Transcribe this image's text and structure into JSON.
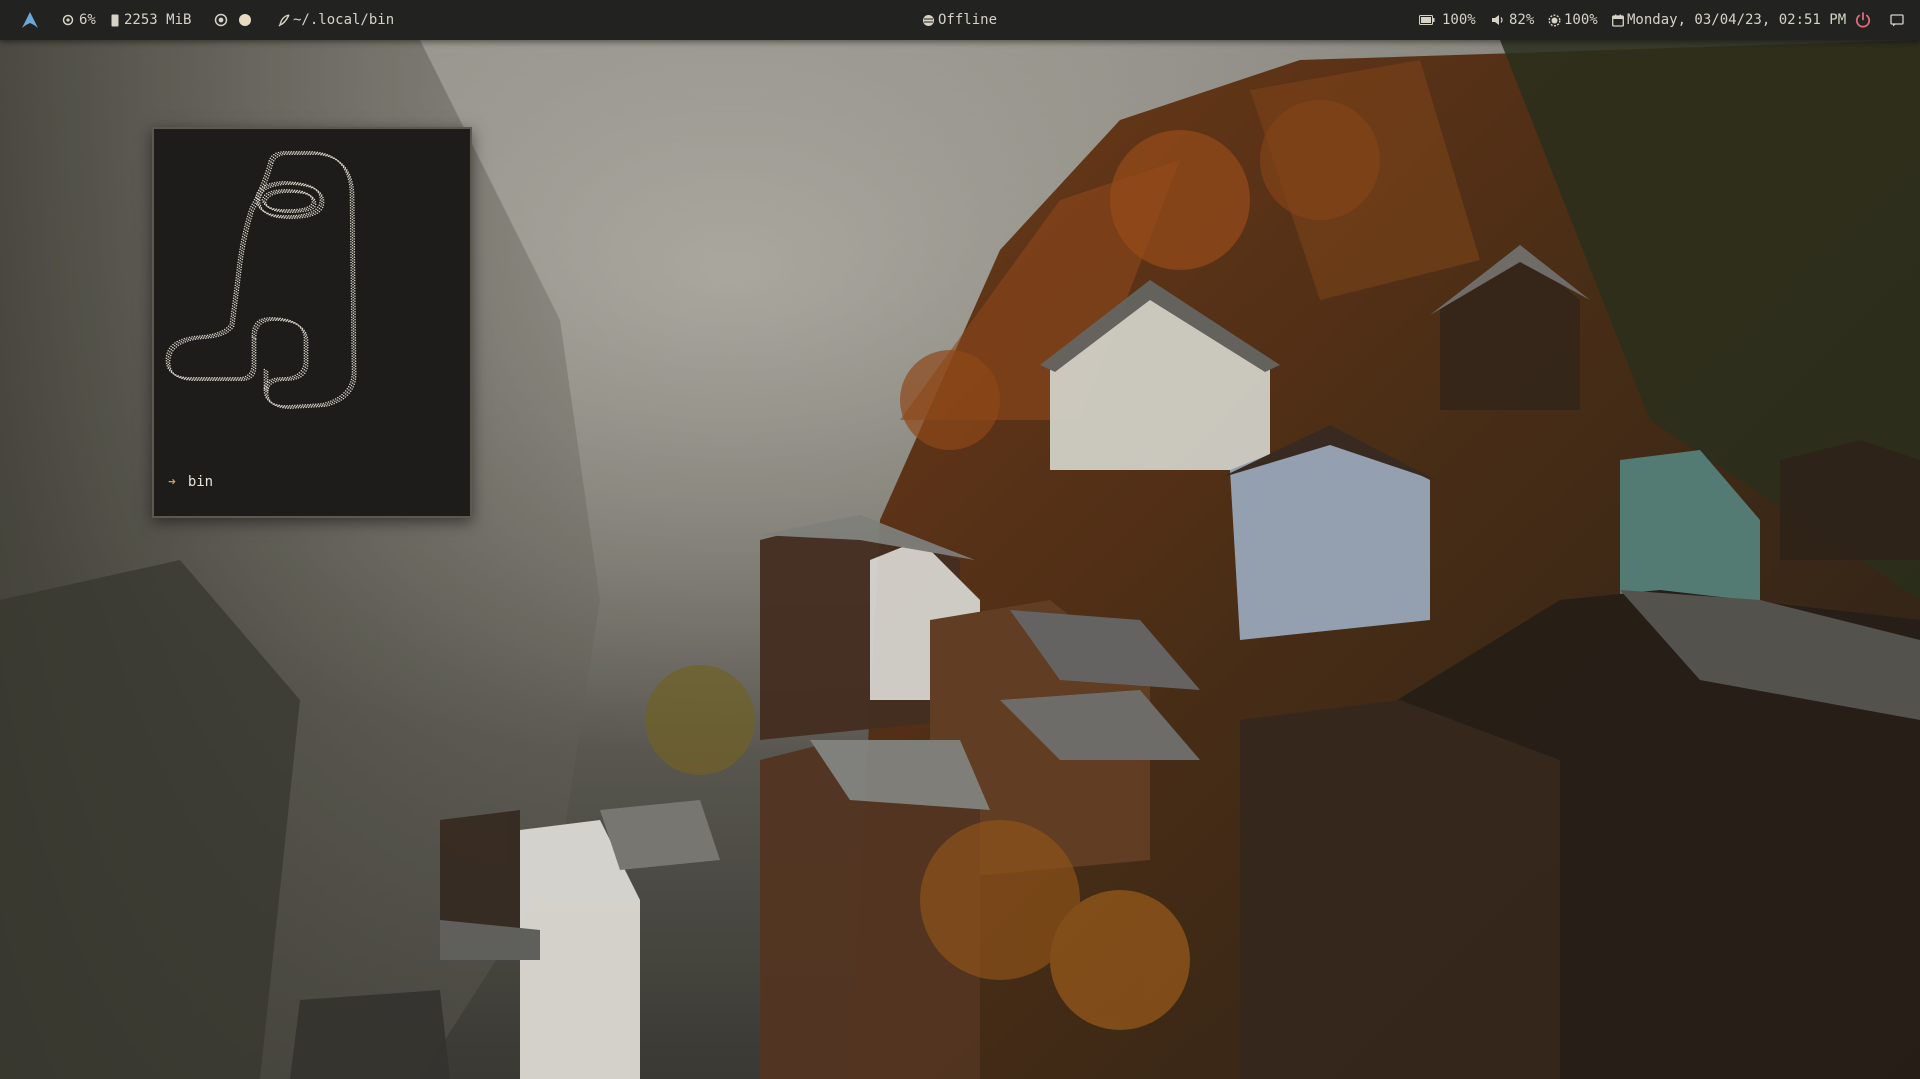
{
  "topbar": {
    "left": {
      "logo_icon": "arch-logo-icon",
      "cpu_icon": "cpu-icon",
      "cpu_value": "6%",
      "memory_icon": "memory-icon",
      "memory_value": "2253 MiB",
      "workspace_icons": [
        "record-icon",
        "dot-icon"
      ],
      "path_icon": "feather-icon",
      "path": "~/.local/bin"
    },
    "center": {
      "network_icon": "globe-icon",
      "network_status": "Offline"
    },
    "right": {
      "battery_icon": "battery-icon",
      "battery_value": "100%",
      "volume_icon": "speaker-icon",
      "volume_value": "82%",
      "brightness_icon": "brightness-icon",
      "brightness_value": "100%",
      "calendar_icon": "calendar-icon",
      "datetime": "Monday, 03/04/23, 02:51 PM",
      "power_icon": "power-icon",
      "notification_icon": "notification-icon"
    },
    "colors": {
      "bar_bg": "#222220",
      "text": "#d6d2c6",
      "accent_logo": "#6ea8d8",
      "power": "#e06a7c"
    }
  },
  "terminal": {
    "prompt_symbol": "➜",
    "directory": "bin",
    "ascii_art_icon": "amogus-dotted-art"
  }
}
